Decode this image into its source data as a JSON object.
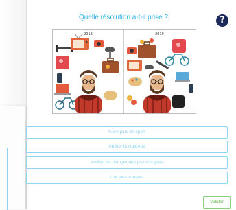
{
  "question": {
    "title": "Quelle résolution a-t-il prise ?"
  },
  "help": {
    "label": "?",
    "icon": "question-circle-icon"
  },
  "illustration": {
    "left_year": "2018",
    "right_year": "2019"
  },
  "options": [
    {
      "label": "Faire plus de sport"
    },
    {
      "label": "Arrêter la cigarette"
    },
    {
      "label": "Arrêter de manger des produits gras"
    },
    {
      "label": "Lire plus souvent"
    }
  ],
  "actions": {
    "validate_label": "Valider"
  },
  "colors": {
    "accent": "#29aee5",
    "help_bg": "#1b2a5a",
    "option_border": "#8fd6ef",
    "validate": "#6db85c"
  }
}
